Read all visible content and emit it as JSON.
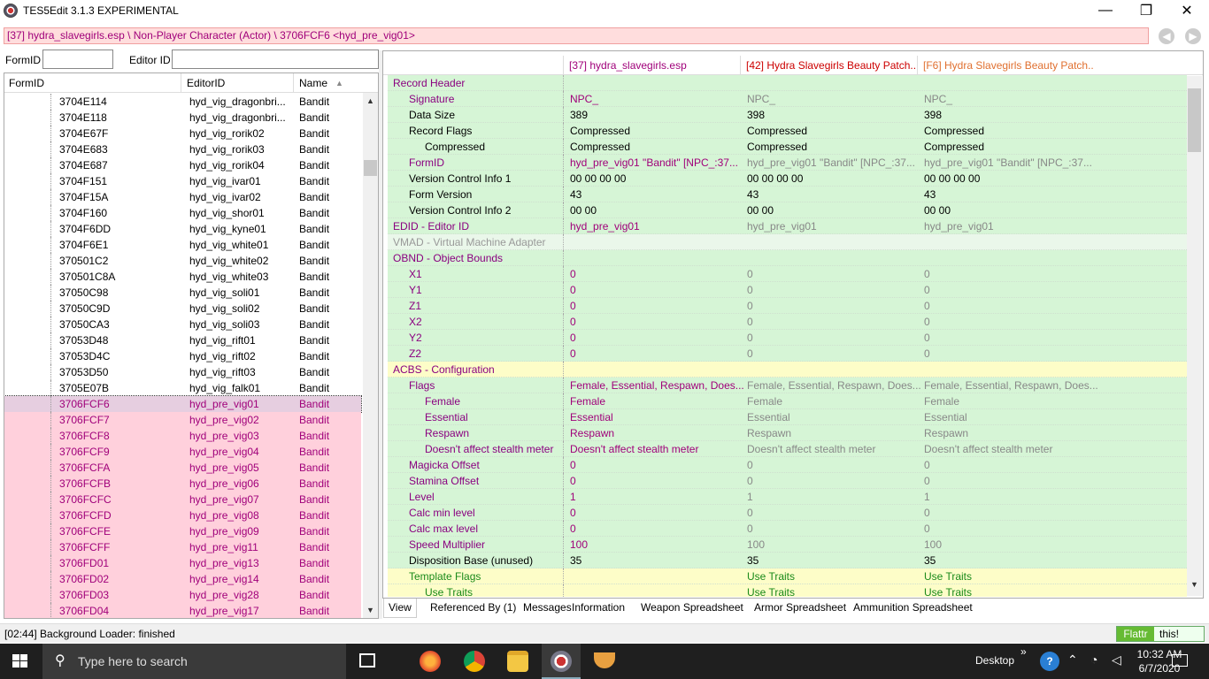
{
  "window": {
    "title": "TES5Edit 3.1.3 EXPERIMENTAL",
    "min": "—",
    "max": "❐",
    "close": "✕"
  },
  "path": "[37] hydra_slavegirls.esp \\ Non-Player Character (Actor) \\ 3706FCF6 <hyd_pre_vig01>",
  "nav": {
    "back": "◀",
    "forward": "▶"
  },
  "filter": {
    "formid_label": "FormID",
    "editorid_label": "Editor ID",
    "formid_value": "",
    "editorid_value": ""
  },
  "left": {
    "headers": [
      "FormID",
      "EditorID",
      "Name"
    ],
    "sort_icon": "▲",
    "rows": [
      {
        "id": "3704E114",
        "eid": "hyd_vig_dragonbri...",
        "name": "Bandit",
        "style": "normal"
      },
      {
        "id": "3704E118",
        "eid": "hyd_vig_dragonbri...",
        "name": "Bandit",
        "style": "normal"
      },
      {
        "id": "3704E67F",
        "eid": "hyd_vig_rorik02",
        "name": "Bandit",
        "style": "normal"
      },
      {
        "id": "3704E683",
        "eid": "hyd_vig_rorik03",
        "name": "Bandit",
        "style": "normal"
      },
      {
        "id": "3704E687",
        "eid": "hyd_vig_rorik04",
        "name": "Bandit",
        "style": "normal"
      },
      {
        "id": "3704F151",
        "eid": "hyd_vig_ivar01",
        "name": "Bandit",
        "style": "normal"
      },
      {
        "id": "3704F15A",
        "eid": "hyd_vig_ivar02",
        "name": "Bandit",
        "style": "normal"
      },
      {
        "id": "3704F160",
        "eid": "hyd_vig_shor01",
        "name": "Bandit",
        "style": "normal"
      },
      {
        "id": "3704F6DD",
        "eid": "hyd_vig_kyne01",
        "name": "Bandit",
        "style": "normal"
      },
      {
        "id": "3704F6E1",
        "eid": "hyd_vig_white01",
        "name": "Bandit",
        "style": "normal"
      },
      {
        "id": "370501C2",
        "eid": "hyd_vig_white02",
        "name": "Bandit",
        "style": "normal"
      },
      {
        "id": "370501C8A",
        "eid": "hyd_vig_white03",
        "name": "Bandit",
        "style": "normal"
      },
      {
        "id": "37050C98",
        "eid": "hyd_vig_soli01",
        "name": "Bandit",
        "style": "normal"
      },
      {
        "id": "37050C9D",
        "eid": "hyd_vig_soli02",
        "name": "Bandit",
        "style": "normal"
      },
      {
        "id": "37050CA3",
        "eid": "hyd_vig_soli03",
        "name": "Bandit",
        "style": "normal"
      },
      {
        "id": "37053D48",
        "eid": "hyd_vig_rift01",
        "name": "Bandit",
        "style": "normal"
      },
      {
        "id": "37053D4C",
        "eid": "hyd_vig_rift02",
        "name": "Bandit",
        "style": "normal"
      },
      {
        "id": "37053D50",
        "eid": "hyd_vig_rift03",
        "name": "Bandit",
        "style": "normal"
      },
      {
        "id": "3705E07B",
        "eid": "hyd_vig_falk01",
        "name": "Bandit",
        "style": "normal"
      },
      {
        "id": "3706FCF6",
        "eid": "hyd_pre_vig01",
        "name": "Bandit",
        "style": "selected"
      },
      {
        "id": "3706FCF7",
        "eid": "hyd_pre_vig02",
        "name": "Bandit",
        "style": "highlight"
      },
      {
        "id": "3706FCF8",
        "eid": "hyd_pre_vig03",
        "name": "Bandit",
        "style": "highlight"
      },
      {
        "id": "3706FCF9",
        "eid": "hyd_pre_vig04",
        "name": "Bandit",
        "style": "highlight"
      },
      {
        "id": "3706FCFA",
        "eid": "hyd_pre_vig05",
        "name": "Bandit",
        "style": "highlight"
      },
      {
        "id": "3706FCFB",
        "eid": "hyd_pre_vig06",
        "name": "Bandit",
        "style": "highlight"
      },
      {
        "id": "3706FCFC",
        "eid": "hyd_pre_vig07",
        "name": "Bandit",
        "style": "highlight"
      },
      {
        "id": "3706FCFD",
        "eid": "hyd_pre_vig08",
        "name": "Bandit",
        "style": "highlight"
      },
      {
        "id": "3706FCFE",
        "eid": "hyd_pre_vig09",
        "name": "Bandit",
        "style": "highlight"
      },
      {
        "id": "3706FCFF",
        "eid": "hyd_pre_vig11",
        "name": "Bandit",
        "style": "highlight"
      },
      {
        "id": "3706FD01",
        "eid": "hyd_pre_vig13",
        "name": "Bandit",
        "style": "highlight"
      },
      {
        "id": "3706FD02",
        "eid": "hyd_pre_vig14",
        "name": "Bandit",
        "style": "highlight"
      },
      {
        "id": "3706FD03",
        "eid": "hyd_pre_vig28",
        "name": "Bandit",
        "style": "highlight"
      },
      {
        "id": "3706FD04",
        "eid": "hyd_pre_vig17",
        "name": "Bandit",
        "style": "highlight"
      }
    ]
  },
  "right": {
    "headers": [
      "",
      "[37] hydra_slavegirls.esp",
      "[42] Hydra Slavegirls Beauty Patch...",
      "[F6] Hydra Slavegirls Beauty Patch..."
    ],
    "header_colors": [
      "#000000",
      "#a0007a",
      "#cc0000",
      "#e07030"
    ],
    "rows": [
      {
        "label": "Record Header",
        "indent": 0,
        "bg": "#d6f5d6",
        "lc": "#8a0080",
        "v": [
          "",
          "",
          ""
        ],
        "vc": [
          "#a0007a",
          "#a0007a",
          "#a0007a"
        ]
      },
      {
        "label": "Signature",
        "indent": 1,
        "bg": "#d6f5d6",
        "lc": "#8a0080",
        "v": [
          "NPC_",
          "NPC_",
          "NPC_"
        ],
        "vc": [
          "#a0007a",
          "#888888",
          "#888888"
        ]
      },
      {
        "label": "Data Size",
        "indent": 1,
        "bg": "#d6f5d6",
        "lc": "#000000",
        "v": [
          "389",
          "398",
          "398"
        ],
        "vc": [
          "#000000",
          "#000000",
          "#000000"
        ]
      },
      {
        "label": "Record Flags",
        "indent": 1,
        "bg": "#d6f5d6",
        "lc": "#000000",
        "v": [
          "Compressed",
          "Compressed",
          "Compressed"
        ],
        "vc": [
          "#000000",
          "#000000",
          "#000000"
        ]
      },
      {
        "label": "Compressed",
        "indent": 2,
        "bg": "#d6f5d6",
        "lc": "#000000",
        "v": [
          "Compressed",
          "Compressed",
          "Compressed"
        ],
        "vc": [
          "#000000",
          "#000000",
          "#000000"
        ]
      },
      {
        "label": "FormID",
        "indent": 1,
        "bg": "#d6f5d6",
        "lc": "#8a0080",
        "v": [
          "hyd_pre_vig01 \"Bandit\" [NPC_:37...",
          "hyd_pre_vig01 \"Bandit\" [NPC_:37...",
          "hyd_pre_vig01 \"Bandit\" [NPC_:37..."
        ],
        "vc": [
          "#a0007a",
          "#888888",
          "#888888"
        ]
      },
      {
        "label": "Version Control Info 1",
        "indent": 1,
        "bg": "#d6f5d6",
        "lc": "#000000",
        "v": [
          "00 00 00 00",
          "00 00 00 00",
          "00 00 00 00"
        ],
        "vc": [
          "#000000",
          "#000000",
          "#000000"
        ]
      },
      {
        "label": "Form Version",
        "indent": 1,
        "bg": "#d6f5d6",
        "lc": "#000000",
        "v": [
          "43",
          "43",
          "43"
        ],
        "vc": [
          "#000000",
          "#000000",
          "#000000"
        ]
      },
      {
        "label": "Version Control Info 2",
        "indent": 1,
        "bg": "#d6f5d6",
        "lc": "#000000",
        "v": [
          "00 00",
          "00 00",
          "00 00"
        ],
        "vc": [
          "#000000",
          "#000000",
          "#000000"
        ]
      },
      {
        "label": "EDID - Editor ID",
        "indent": 0,
        "bg": "#d6f5d6",
        "lc": "#8a0080",
        "v": [
          "hyd_pre_vig01",
          "hyd_pre_vig01",
          "hyd_pre_vig01"
        ],
        "vc": [
          "#a0007a",
          "#888888",
          "#888888"
        ]
      },
      {
        "label": "VMAD - Virtual Machine Adapter",
        "indent": 0,
        "bg": "#eaf7ea",
        "lc": "#999999",
        "v": [
          "",
          "",
          ""
        ],
        "vc": [
          "#888888",
          "#888888",
          "#888888"
        ]
      },
      {
        "label": "OBND - Object Bounds",
        "indent": 0,
        "bg": "#d6f5d6",
        "lc": "#8a0080",
        "v": [
          "",
          "",
          ""
        ],
        "vc": [
          "#888888",
          "#888888",
          "#888888"
        ]
      },
      {
        "label": "X1",
        "indent": 1,
        "bg": "#d6f5d6",
        "lc": "#8a0080",
        "v": [
          "0",
          "0",
          "0"
        ],
        "vc": [
          "#a0007a",
          "#888888",
          "#888888"
        ]
      },
      {
        "label": "Y1",
        "indent": 1,
        "bg": "#d6f5d6",
        "lc": "#8a0080",
        "v": [
          "0",
          "0",
          "0"
        ],
        "vc": [
          "#a0007a",
          "#888888",
          "#888888"
        ]
      },
      {
        "label": "Z1",
        "indent": 1,
        "bg": "#d6f5d6",
        "lc": "#8a0080",
        "v": [
          "0",
          "0",
          "0"
        ],
        "vc": [
          "#a0007a",
          "#888888",
          "#888888"
        ]
      },
      {
        "label": "X2",
        "indent": 1,
        "bg": "#d6f5d6",
        "lc": "#8a0080",
        "v": [
          "0",
          "0",
          "0"
        ],
        "vc": [
          "#a0007a",
          "#888888",
          "#888888"
        ]
      },
      {
        "label": "Y2",
        "indent": 1,
        "bg": "#d6f5d6",
        "lc": "#8a0080",
        "v": [
          "0",
          "0",
          "0"
        ],
        "vc": [
          "#a0007a",
          "#888888",
          "#888888"
        ]
      },
      {
        "label": "Z2",
        "indent": 1,
        "bg": "#d6f5d6",
        "lc": "#8a0080",
        "v": [
          "0",
          "0",
          "0"
        ],
        "vc": [
          "#a0007a",
          "#888888",
          "#888888"
        ]
      },
      {
        "label": "ACBS - Configuration",
        "indent": 0,
        "bg": "#fdfdc8",
        "lc": "#8a0080",
        "v": [
          "",
          "",
          ""
        ],
        "vc": [
          "#888888",
          "#888888",
          "#888888"
        ]
      },
      {
        "label": "Flags",
        "indent": 1,
        "bg": "#d6f5d6",
        "lc": "#8a0080",
        "v": [
          "Female, Essential, Respawn, Does...",
          "Female, Essential, Respawn, Does...",
          "Female, Essential, Respawn, Does..."
        ],
        "vc": [
          "#a0007a",
          "#888888",
          "#888888"
        ]
      },
      {
        "label": "Female",
        "indent": 2,
        "bg": "#d6f5d6",
        "lc": "#8a0080",
        "v": [
          "Female",
          "Female",
          "Female"
        ],
        "vc": [
          "#a0007a",
          "#888888",
          "#888888"
        ]
      },
      {
        "label": "Essential",
        "indent": 2,
        "bg": "#d6f5d6",
        "lc": "#8a0080",
        "v": [
          "Essential",
          "Essential",
          "Essential"
        ],
        "vc": [
          "#a0007a",
          "#888888",
          "#888888"
        ]
      },
      {
        "label": "Respawn",
        "indent": 2,
        "bg": "#d6f5d6",
        "lc": "#8a0080",
        "v": [
          "Respawn",
          "Respawn",
          "Respawn"
        ],
        "vc": [
          "#a0007a",
          "#888888",
          "#888888"
        ]
      },
      {
        "label": "Doesn't affect stealth meter",
        "indent": 2,
        "bg": "#d6f5d6",
        "lc": "#8a0080",
        "v": [
          "Doesn't affect stealth meter",
          "Doesn't affect stealth meter",
          "Doesn't affect stealth meter"
        ],
        "vc": [
          "#a0007a",
          "#888888",
          "#888888"
        ]
      },
      {
        "label": "Magicka Offset",
        "indent": 1,
        "bg": "#d6f5d6",
        "lc": "#8a0080",
        "v": [
          "0",
          "0",
          "0"
        ],
        "vc": [
          "#a0007a",
          "#888888",
          "#888888"
        ]
      },
      {
        "label": "Stamina Offset",
        "indent": 1,
        "bg": "#d6f5d6",
        "lc": "#8a0080",
        "v": [
          "0",
          "0",
          "0"
        ],
        "vc": [
          "#a0007a",
          "#888888",
          "#888888"
        ]
      },
      {
        "label": "Level",
        "indent": 1,
        "bg": "#d6f5d6",
        "lc": "#8a0080",
        "v": [
          "1",
          "1",
          "1"
        ],
        "vc": [
          "#a0007a",
          "#888888",
          "#888888"
        ]
      },
      {
        "label": "Calc min level",
        "indent": 1,
        "bg": "#d6f5d6",
        "lc": "#8a0080",
        "v": [
          "0",
          "0",
          "0"
        ],
        "vc": [
          "#a0007a",
          "#888888",
          "#888888"
        ]
      },
      {
        "label": "Calc max level",
        "indent": 1,
        "bg": "#d6f5d6",
        "lc": "#8a0080",
        "v": [
          "0",
          "0",
          "0"
        ],
        "vc": [
          "#a0007a",
          "#888888",
          "#888888"
        ]
      },
      {
        "label": "Speed Multiplier",
        "indent": 1,
        "bg": "#d6f5d6",
        "lc": "#8a0080",
        "v": [
          "100",
          "100",
          "100"
        ],
        "vc": [
          "#a0007a",
          "#888888",
          "#888888"
        ]
      },
      {
        "label": "Disposition Base (unused)",
        "indent": 1,
        "bg": "#d6f5d6",
        "lc": "#000000",
        "v": [
          "35",
          "35",
          "35"
        ],
        "vc": [
          "#000000",
          "#000000",
          "#000000"
        ]
      },
      {
        "label": "Template Flags",
        "indent": 1,
        "bg": "#fdfdc8",
        "lc": "#1a8a1a",
        "v": [
          "",
          "Use Traits",
          "Use Traits"
        ],
        "vc": [
          "#1a8a1a",
          "#1a8a1a",
          "#1a8a1a"
        ]
      },
      {
        "label": "Use Traits",
        "indent": 2,
        "bg": "#fdfdc8",
        "lc": "#1a8a1a",
        "v": [
          "",
          "Use Traits",
          "Use Traits"
        ],
        "vc": [
          "#1a8a1a",
          "#1a8a1a",
          "#1a8a1a"
        ]
      }
    ]
  },
  "tabs": [
    "View",
    "Referenced By (1)",
    "Messages",
    "Information",
    "Weapon Spreadsheet",
    "Armor Spreadsheet",
    "Ammunition Spreadsheet"
  ],
  "status": "[02:44] Background Loader: finished",
  "flattr": {
    "label": "Flattr",
    "this": "this!"
  },
  "taskbar": {
    "search_placeholder": "Type here to search",
    "desktop": "Desktop",
    "chevron": "»",
    "time": "10:32 AM",
    "date": "6/7/2020"
  }
}
